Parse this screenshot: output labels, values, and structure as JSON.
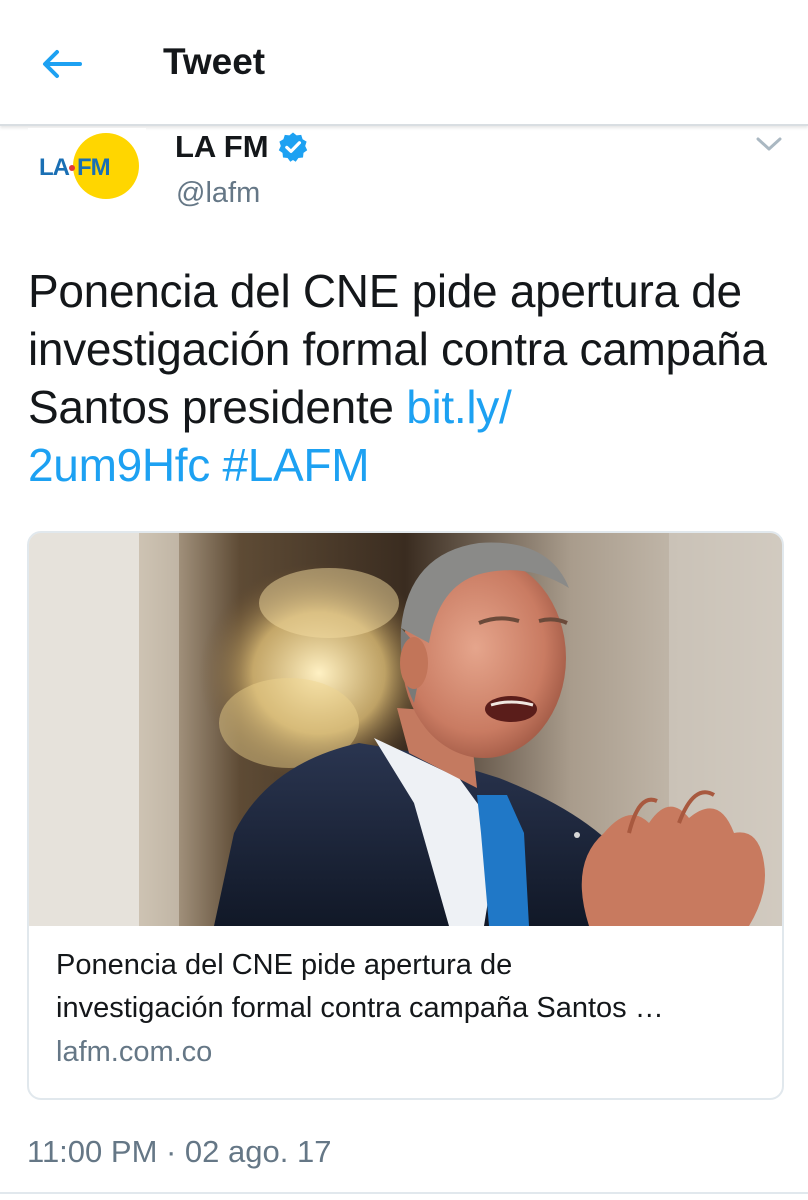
{
  "header": {
    "title": "Tweet",
    "back_icon": "arrow-left-icon"
  },
  "author": {
    "name": "LA FM",
    "handle": "@lafm",
    "verified": true,
    "avatar_logo_text": "LA·FM"
  },
  "tweet": {
    "text": "Ponencia del CNE pide apertura de investigación formal contra campaña Santos presidente",
    "link_part1": "bit.ly/",
    "link_part2": "2um9Hfc",
    "hashtag": "#LAFM"
  },
  "card": {
    "title_line1": "Ponencia del CNE pide apertura de",
    "title_line2": "investigación formal contra campaña Santos …",
    "domain": "lafm.com.co"
  },
  "meta": {
    "timestamp": "11:00 PM · 02 ago. 17"
  },
  "colors": {
    "accent": "#1da1f2",
    "text": "#14171a",
    "secondary": "#657786",
    "border": "#e1e8ed",
    "logo_yellow": "#ffd600",
    "logo_blue": "#1a6fb4"
  }
}
